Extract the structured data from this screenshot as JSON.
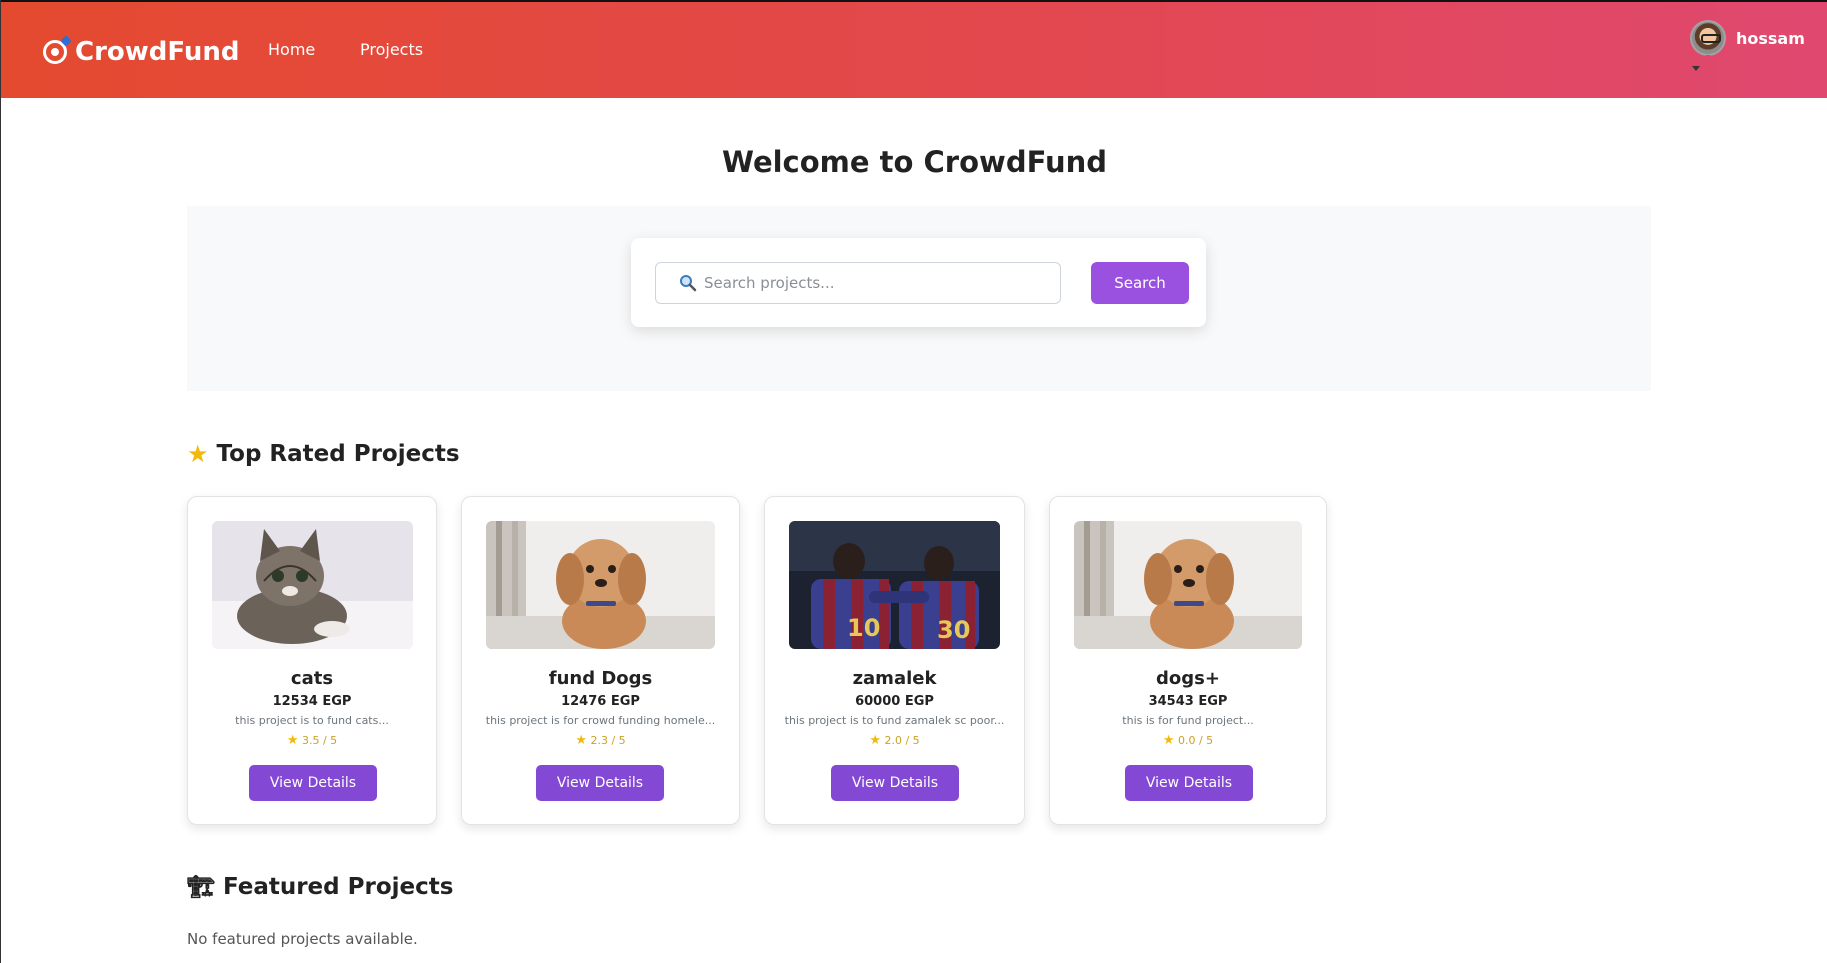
{
  "navbar": {
    "brand": "CrowdFund",
    "links": [
      {
        "label": "Home"
      },
      {
        "label": "Projects"
      }
    ],
    "user": {
      "name": "hossam"
    }
  },
  "hero": {
    "title": "Welcome to CrowdFund"
  },
  "search": {
    "placeholder": "Search projects...",
    "button_label": "Search"
  },
  "top_rated": {
    "title": "Top Rated Projects",
    "projects": [
      {
        "title": "cats",
        "goal": "12534 EGP",
        "description": "this project is to fund cats...",
        "rating": "3.5 / 5",
        "button": "View Details",
        "image": "kitten-photo"
      },
      {
        "title": "fund Dogs",
        "goal": "12476 EGP",
        "description": "this project is for crowd funding homele...",
        "rating": "2.3 / 5",
        "button": "View Details",
        "image": "dog-photo"
      },
      {
        "title": "zamalek",
        "goal": "60000 EGP",
        "description": "this project is to fund zamalek sc poor...",
        "rating": "2.0 / 5",
        "button": "View Details",
        "image": "footballers-photo"
      },
      {
        "title": "dogs+",
        "goal": "34543 EGP",
        "description": "this is for fund project...",
        "rating": "0.0 / 5",
        "button": "View Details",
        "image": "dog-photo"
      }
    ]
  },
  "featured": {
    "title": "Featured Projects",
    "empty_message": "No featured projects available."
  },
  "colors": {
    "navbar_start": "#e44a2f",
    "navbar_end": "#e04870",
    "search_button": "#9b51e0",
    "card_button": "#8348d4",
    "rating": "#c9a227"
  }
}
